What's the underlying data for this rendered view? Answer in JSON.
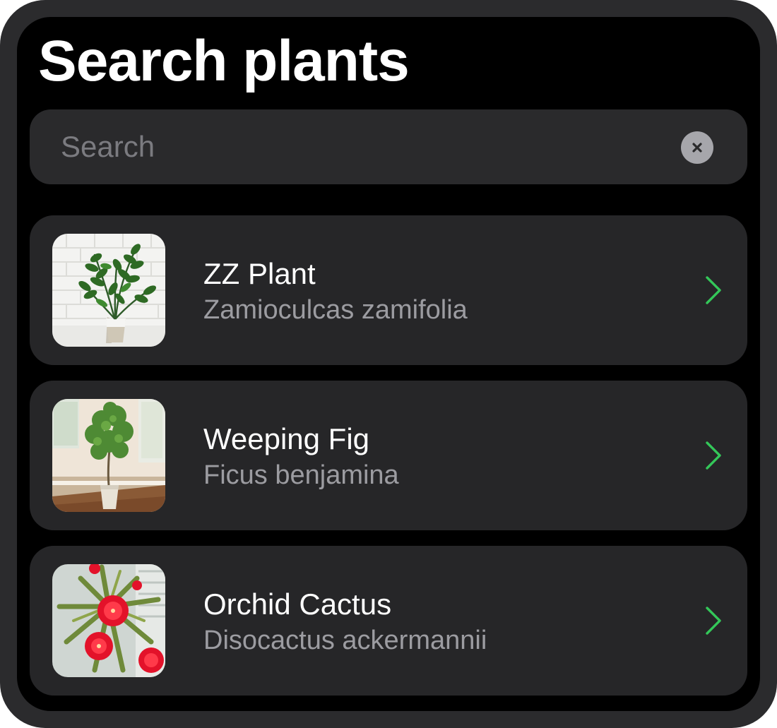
{
  "header": {
    "title": "Search plants"
  },
  "search": {
    "placeholder": "Search",
    "value": "",
    "clear_icon": "xmark-circle-fill-icon"
  },
  "plants": [
    {
      "common_name": "ZZ Plant",
      "scientific_name": "Zamioculcas zamifolia",
      "thumbnail": "zz-plant-photo"
    },
    {
      "common_name": "Weeping Fig",
      "scientific_name": "Ficus benjamina",
      "thumbnail": "weeping-fig-photo"
    },
    {
      "common_name": "Orchid Cactus",
      "scientific_name": "Disocactus ackermannii",
      "thumbnail": "orchid-cactus-photo"
    }
  ],
  "colors": {
    "accent": "#34c759",
    "background": "#000000",
    "card": "#262628",
    "secondary_text": "#9c9ca1"
  },
  "icons": {
    "row_disclosure": "chevron-right-icon"
  }
}
